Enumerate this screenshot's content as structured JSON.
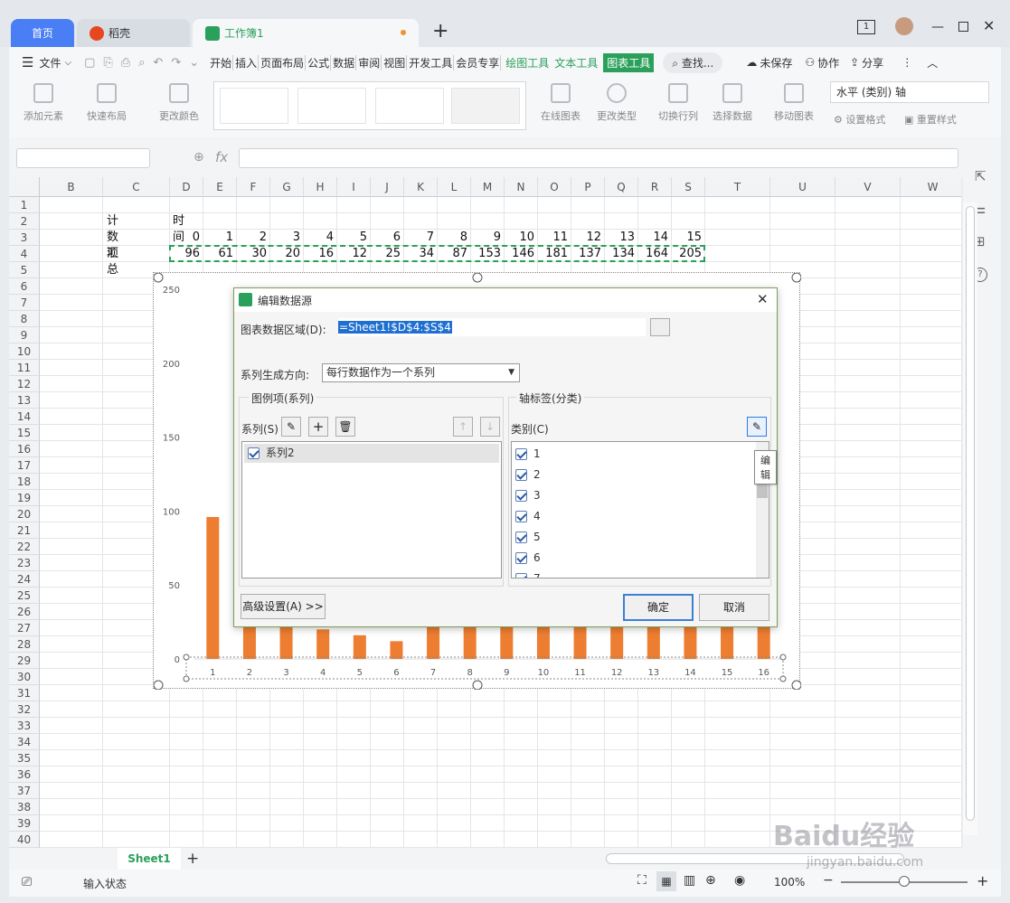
{
  "tabs": {
    "home": "首页",
    "daoke": "稻壳",
    "workbook": "工作簿1",
    "new": "+"
  },
  "menu": {
    "file": "文件",
    "items": [
      "开始",
      "插入",
      "页面布局",
      "公式",
      "数据",
      "审阅",
      "视图",
      "开发工具",
      "会员专享"
    ],
    "contextual": [
      "绘图工具",
      "文本工具"
    ],
    "active": "图表工具",
    "search": "查找...",
    "unsaved": "未保存",
    "collab": "协作",
    "share": "分享"
  },
  "ribbon": {
    "add_element": "添加元素",
    "quick_layout": "快速布局",
    "change_color": "更改颜色",
    "online_chart": "在线图表",
    "change_type": "更改类型",
    "switch_rowcol": "切换行列",
    "select_data": "选择数据",
    "move_chart": "移动图表",
    "axis_select": "水平 (类别) 轴",
    "set_format": "设置格式",
    "reset_style": "重置样式"
  },
  "formula": {
    "fx": "fx"
  },
  "columns": [
    "B",
    "C",
    "D",
    "E",
    "F",
    "G",
    "H",
    "I",
    "J",
    "K",
    "L",
    "M",
    "N",
    "O",
    "P",
    "Q",
    "R",
    "S",
    "T",
    "U",
    "V",
    "W"
  ],
  "rows": [
    "1",
    "2",
    "3",
    "4",
    "5",
    "6",
    "7",
    "8",
    "9",
    "10",
    "11",
    "12",
    "13",
    "14",
    "15",
    "16",
    "17",
    "18",
    "19",
    "20",
    "21",
    "22",
    "23",
    "24",
    "25",
    "26",
    "27",
    "28",
    "29",
    "30",
    "31",
    "32",
    "33",
    "34",
    "35",
    "36",
    "37",
    "38",
    "39",
    "40"
  ],
  "cells": {
    "label_count": "计数项",
    "label_time": "时间",
    "label_total": "汇总",
    "times": [
      "0",
      "1",
      "2",
      "3",
      "4",
      "5",
      "6",
      "7",
      "8",
      "9",
      "10",
      "11",
      "12",
      "13",
      "14",
      "15"
    ],
    "totals": [
      "96",
      "61",
      "30",
      "20",
      "16",
      "12",
      "25",
      "34",
      "87",
      "153",
      "146",
      "181",
      "137",
      "134",
      "164",
      "205"
    ]
  },
  "chart_data": {
    "type": "bar",
    "categories": [
      "1",
      "2",
      "3",
      "4",
      "5",
      "6",
      "7",
      "8",
      "9",
      "10",
      "11",
      "12",
      "13",
      "14",
      "15",
      "16"
    ],
    "series": [
      {
        "values": [
          96,
          61,
          30,
          20,
          16,
          12,
          25,
          34,
          87,
          153,
          146,
          181,
          137,
          134,
          164,
          205
        ]
      }
    ],
    "ylim": [
      0,
      250
    ],
    "yticks": [
      "0",
      "50",
      "100",
      "150",
      "200",
      "250"
    ],
    "color": "#ed7d31"
  },
  "dialog": {
    "title": "编辑数据源",
    "range_label": "图表数据区域(D):",
    "range_value": "=Sheet1!$D$4:$S$4",
    "direction_label": "系列生成方向:",
    "direction_value": "每行数据作为一个系列",
    "legend_group": "图例项(系列)",
    "series_label": "系列(S)",
    "series_items": [
      "系列2"
    ],
    "axis_group": "轴标签(分类)",
    "category_label": "类别(C)",
    "category_items": [
      "1",
      "2",
      "3",
      "4",
      "5",
      "6",
      "7"
    ],
    "tooltip": "编辑",
    "advanced": "高级设置(A) >>",
    "ok": "确定",
    "cancel": "取消"
  },
  "sheet_tab": "Sheet1",
  "status": {
    "input_state": "输入状态",
    "zoom": "100%"
  },
  "watermark": "Baidu经验 jingyan.baidu.com"
}
